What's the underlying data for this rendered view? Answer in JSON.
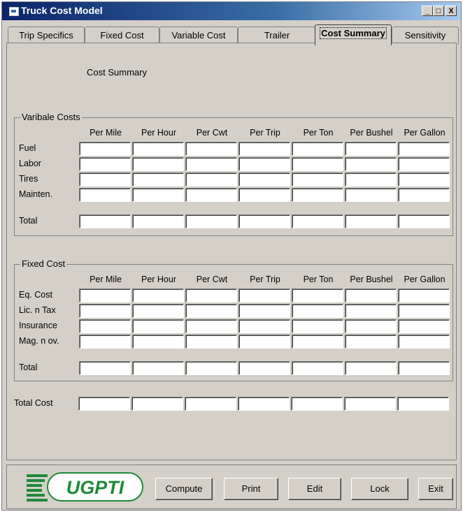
{
  "window": {
    "title": "Truck Cost Model"
  },
  "titlebar_buttons": {
    "minimize": "_",
    "maximize": "□",
    "close": "X"
  },
  "tabs": [
    {
      "label": "Trip Specifics"
    },
    {
      "label": "Fixed Cost"
    },
    {
      "label": "Variable Cost"
    },
    {
      "label": "Trailer"
    },
    {
      "label": "Cost Summary",
      "active": true
    },
    {
      "label": "Sensitivity"
    }
  ],
  "panel": {
    "caption": "Cost Summary"
  },
  "columns": [
    "Per Mile",
    "Per Hour",
    "Per Cwt",
    "Per Trip",
    "Per Ton",
    "Per Bushel",
    "Per Gallon"
  ],
  "variable_costs": {
    "legend": "Varibale Costs",
    "rows": [
      "Fuel",
      "Labor",
      "Tires",
      "Mainten."
    ],
    "total_label": "Total"
  },
  "fixed_cost": {
    "legend": "Fixed Cost",
    "rows": [
      "Eq. Cost",
      "Lic. n Tax",
      "Insurance",
      "Mag. n ov."
    ],
    "total_label": "Total"
  },
  "total_cost_label": "Total Cost",
  "logo_text": "UGPTI",
  "buttons": {
    "compute": "Compute",
    "print": "Print",
    "edit": "Edit",
    "lock": "Lock",
    "exit": "Exit"
  },
  "colors": {
    "titlebar": "#0a246a",
    "face": "#d4d0c8",
    "logo_green": "#1f8a3a"
  }
}
